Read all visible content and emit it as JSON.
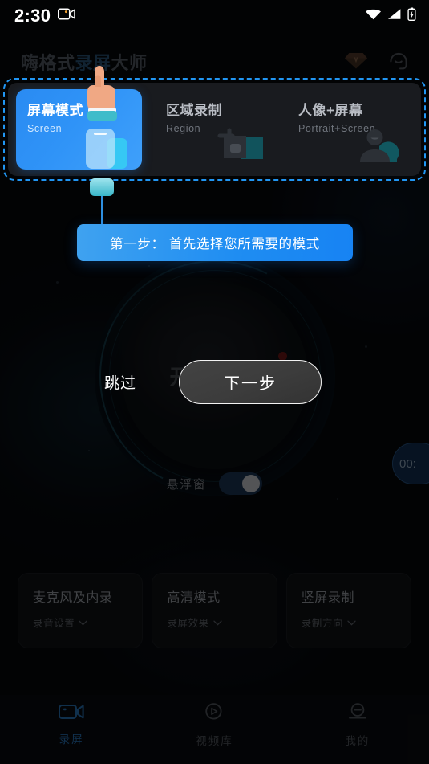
{
  "status_bar": {
    "time": "2:30",
    "recording_icon": "camcorder-icon",
    "wifi_icon": "wifi-icon",
    "signal_icon": "cellular-signal-icon",
    "battery_icon": "battery-charging-icon"
  },
  "header": {
    "title_prefix": "嗨格式",
    "title_highlight": "录屏",
    "title_suffix": "大师",
    "vip_icon": "diamond-vip-icon",
    "support_icon": "headset-support-icon"
  },
  "mode_panel": {
    "cards": [
      {
        "title": "屏幕模式",
        "subtitle": "Screen",
        "active": true,
        "icon": "phone-screen-icon"
      },
      {
        "title": "区域录制",
        "subtitle": "Region",
        "active": false,
        "icon": "region-crop-icon"
      },
      {
        "title": "人像+屏幕",
        "subtitle": "Portrait+Screen",
        "active": false,
        "icon": "person-portrait-icon"
      }
    ]
  },
  "onboarding": {
    "tooltip_text": "第一步： 首先选择您所需要的模式",
    "skip_label": "跳过",
    "next_label": "下一步",
    "pointer_icon": "pointing-hand-icon"
  },
  "dial": {
    "label": "开始录屏",
    "rec_dot_color": "#7a1a18"
  },
  "float_window": {
    "label": "悬浮窗",
    "enabled": true
  },
  "timer_chip": {
    "text": "00:"
  },
  "options": [
    {
      "title": "麦克风及内录",
      "subtitle": "录音设置",
      "chevron": "chevron-down-icon"
    },
    {
      "title": "高清模式",
      "subtitle": "录屏效果",
      "chevron": "chevron-down-icon"
    },
    {
      "title": "竖屏录制",
      "subtitle": "录制方向",
      "chevron": "chevron-down-icon"
    }
  ],
  "bottom_nav": [
    {
      "label": "录屏",
      "icon": "video-camera-icon",
      "active": true
    },
    {
      "label": "视频库",
      "icon": "play-circle-icon",
      "active": false
    },
    {
      "label": "我的",
      "icon": "user-profile-icon",
      "active": false
    }
  ],
  "colors": {
    "accent_blue": "#2196f3",
    "card_blue_start": "#2a8bf2",
    "card_blue_end": "#3fa0fb",
    "nav_active": "#2b7ec9",
    "panel_bg": "#191b1f",
    "page_bg": "#07090d"
  }
}
